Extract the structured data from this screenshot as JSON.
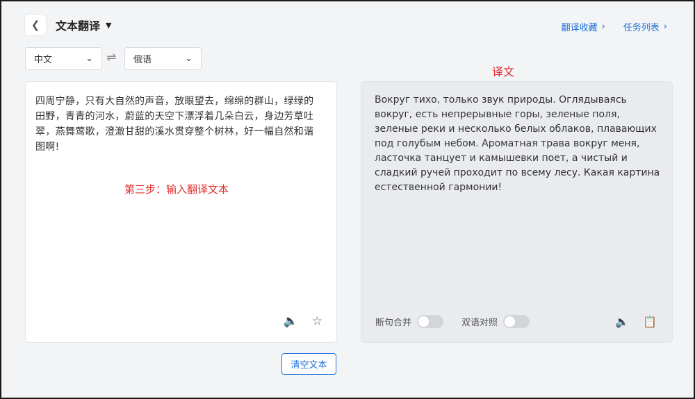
{
  "header": {
    "back_icon": "chevron-left-icon",
    "title": "文本翻译",
    "title_caret": "▼",
    "links": [
      {
        "label": "翻译收藏",
        "icon": "chevron-right-icon"
      },
      {
        "label": "任务列表",
        "icon": "chevron-right-icon"
      }
    ]
  },
  "languages": {
    "source": {
      "value": "中文",
      "icon": "chevron-down-icon"
    },
    "swap_icon": "swap-arrows-icon",
    "target": {
      "value": "俄语",
      "icon": "chevron-down-icon"
    }
  },
  "source_panel": {
    "text": "四周宁静，只有大自然的声音，放眼望去，绵绵的群山，绿绿的田野，青青的河水，蔚蓝的天空下漂浮着几朵白云，身边芳草吐翠，燕舞莺歌，澄澈甘甜的溪水贯穿整个树林，好一幅自然和谐图啊!",
    "annotation": "第三步：输入翻译文本",
    "tools": [
      "speaker-icon",
      "star-icon"
    ]
  },
  "result_panel": {
    "annotation": "译文",
    "text": "Вокруг тихо, только звук природы. Оглядываясь вокруг, есть непрерывные горы, зеленые поля, зеленые реки и несколько белых облаков, плавающих под голубым небом. Ароматная трава вокруг меня, ласточка танцует и камышевки поет, а чистый и сладкий ручей проходит по всему лесу. Какая картина естественной гармонии!",
    "toggles": [
      {
        "label": "断句合并",
        "on": false
      },
      {
        "label": "双语对照",
        "on": false
      }
    ],
    "tools": [
      "speaker-icon",
      "copy-icon"
    ]
  },
  "actions": {
    "clear_label": "清空文本"
  },
  "colors": {
    "accent": "#1c6fd8",
    "annotation": "#e02c2c",
    "result_bg": "#e9ebee"
  }
}
